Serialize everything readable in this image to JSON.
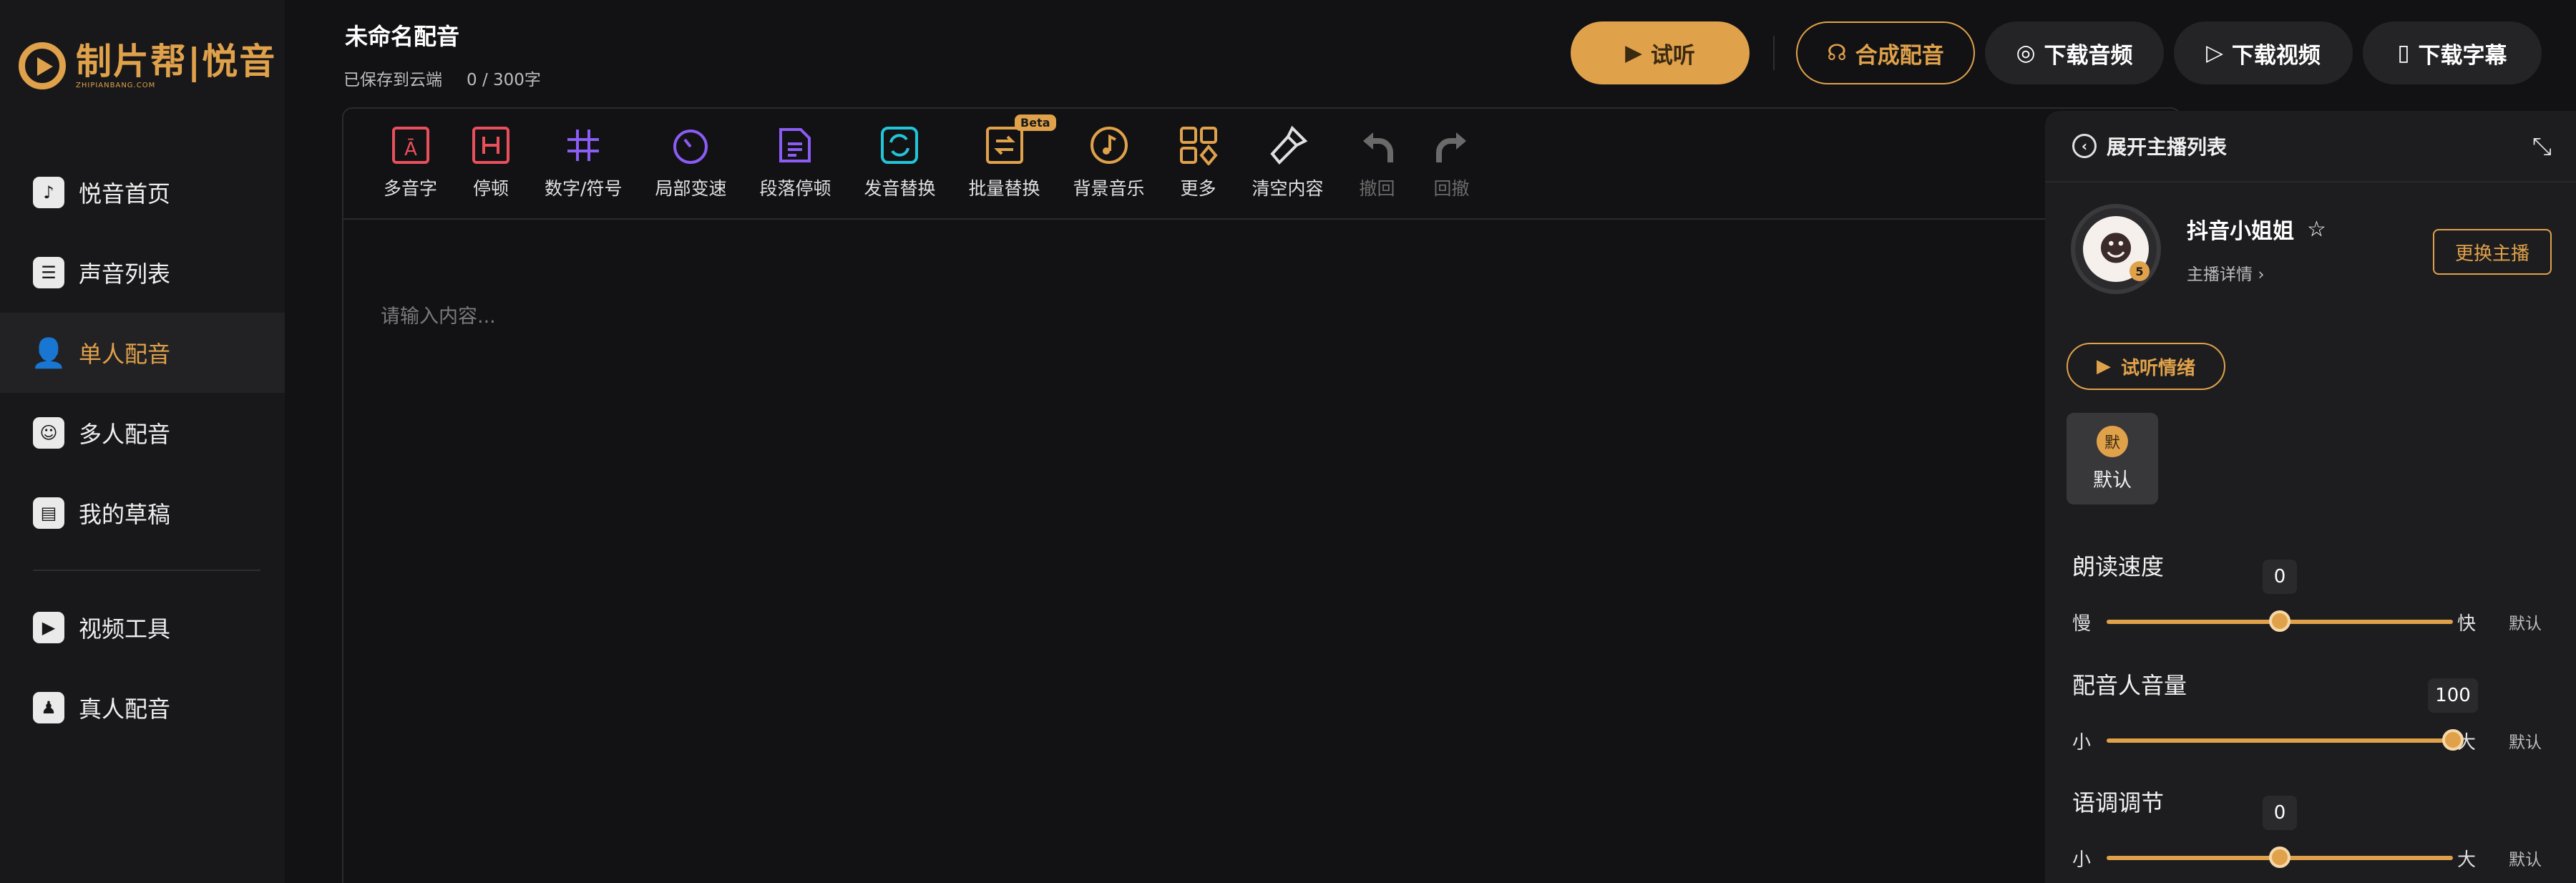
{
  "brand": {
    "name": "制片帮|悦音",
    "sub": "ZHIPIANBANG.COM"
  },
  "sidebar": {
    "items": [
      {
        "label": "悦音首页",
        "icon": "music-icon",
        "active": false
      },
      {
        "label": "声音列表",
        "icon": "list-icon",
        "active": false
      },
      {
        "label": "单人配音",
        "icon": "user-icon",
        "active": true
      },
      {
        "label": "多人配音",
        "icon": "users-icon",
        "active": false
      },
      {
        "label": "我的草稿",
        "icon": "draft-icon",
        "active": false
      },
      {
        "label": "视频工具",
        "icon": "video-camera-icon",
        "active": false
      },
      {
        "label": "真人配音",
        "icon": "person-voice-icon",
        "active": false
      }
    ]
  },
  "header": {
    "title": "未命名配音",
    "save_status": "已保存到云端",
    "word_count": "0 / 300字",
    "preview_label": "试听",
    "synthesize_label": "合成配音",
    "download_audio_label": "下载音频",
    "download_video_label": "下载视频",
    "download_subtitle_label": "下载字幕"
  },
  "toolbar": {
    "items": [
      {
        "label": "多音字",
        "icon": "polyphone-icon",
        "color": "#e8505b"
      },
      {
        "label": "停顿",
        "icon": "pause-icon",
        "color": "#e8505b"
      },
      {
        "label": "数字/符号",
        "icon": "hash-icon",
        "color": "#8b5cf6"
      },
      {
        "label": "局部变速",
        "icon": "speed-icon",
        "color": "#8b5cf6"
      },
      {
        "label": "段落停顿",
        "icon": "paragraph-pause-icon",
        "color": "#8b5cf6"
      },
      {
        "label": "发音替换",
        "icon": "replace-pronounce-icon",
        "color": "#22c5d8"
      },
      {
        "label": "批量替换",
        "icon": "batch-replace-icon",
        "color": "#e0a14b",
        "badge": "Beta"
      },
      {
        "label": "背景音乐",
        "icon": "music-note-icon",
        "color": "#e0a14b"
      },
      {
        "label": "更多",
        "icon": "more-grid-icon",
        "color": "#e0a14b"
      },
      {
        "label": "清空内容",
        "icon": "broom-icon",
        "color": "#e0e0e0"
      },
      {
        "label": "撤回",
        "icon": "undo-icon",
        "color": "#6a6a6a",
        "disabled": true
      },
      {
        "label": "回撤",
        "icon": "redo-icon",
        "color": "#6a6a6a",
        "disabled": true
      }
    ]
  },
  "editor": {
    "placeholder": "请输入内容..."
  },
  "panel": {
    "expand_label": "展开主播列表",
    "anchor_name": "抖音小姐姐",
    "anchor_detail": "主播详情",
    "avatar_badge": "5",
    "change_label": "更换主播",
    "emotion_label": "试听情绪",
    "mood_icon_text": "默",
    "mood_label": "默认",
    "sliders": [
      {
        "label": "朗读速度",
        "min": "慢",
        "max": "快",
        "value": "0",
        "fraction": 0.5,
        "default": "默认"
      },
      {
        "label": "配音人音量",
        "min": "小",
        "max": "大",
        "value": "100",
        "fraction": 1.0,
        "default": "默认"
      },
      {
        "label": "语调调节",
        "min": "小",
        "max": "大",
        "value": "0",
        "fraction": 0.5,
        "default": "默认"
      }
    ]
  }
}
